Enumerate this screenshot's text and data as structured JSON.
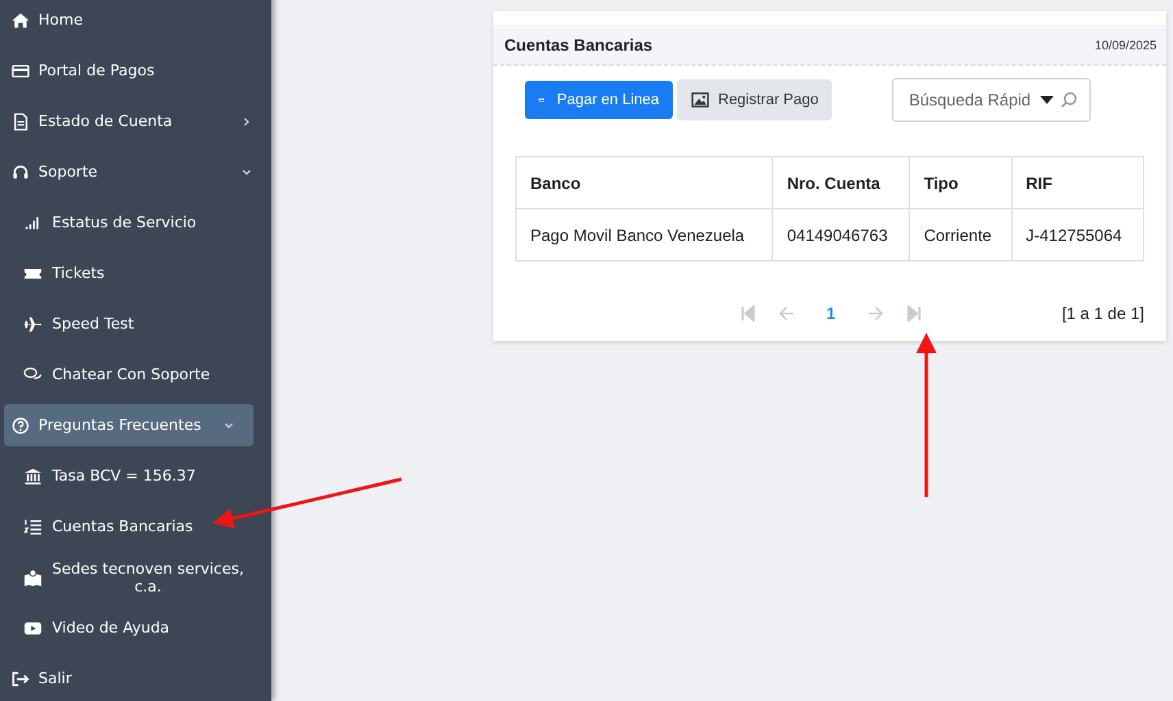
{
  "sidebar": {
    "items": [
      {
        "label": "Home",
        "selected": false
      },
      {
        "label": "Portal de Pagos",
        "selected": false
      },
      {
        "label": "Estado de Cuenta",
        "selected": false,
        "expanded": false
      },
      {
        "label": "Soporte",
        "selected": false,
        "expanded": true,
        "children": [
          {
            "label": "Estatus de Servicio"
          },
          {
            "label": "Tickets"
          },
          {
            "label": "Speed Test"
          },
          {
            "label": "Chatear Con Soporte"
          }
        ]
      },
      {
        "label": "Preguntas Frecuentes",
        "selected": true,
        "expanded": true,
        "children": [
          {
            "label": "Tasa BCV = 156.37"
          },
          {
            "label": "Cuentas Bancarias"
          },
          {
            "label": "Sedes tecnoven services, c.a."
          },
          {
            "label": "Video de Ayuda"
          }
        ]
      },
      {
        "label": "Salir",
        "selected": false
      }
    ]
  },
  "card": {
    "title": "Cuentas Bancarias",
    "date": "10/09/2025",
    "buttons": [
      {
        "label": "Pagar en Linea",
        "kind": "primary"
      },
      {
        "label": "Registrar Pago",
        "kind": "secondary"
      }
    ],
    "search": {
      "placeholder": "Búsqueda Rápid"
    },
    "table": {
      "columns": [
        "Banco",
        "Nro. Cuenta",
        "Tipo",
        "RIF"
      ],
      "rows": [
        [
          "Pago Movil Banco Venezuela",
          "04149046763",
          "Corriente",
          "J-412755064"
        ]
      ]
    },
    "pagination": {
      "pages": [
        {
          "label": "1",
          "selected": true
        }
      ],
      "summary": "[1 a 1 de 1]"
    }
  }
}
